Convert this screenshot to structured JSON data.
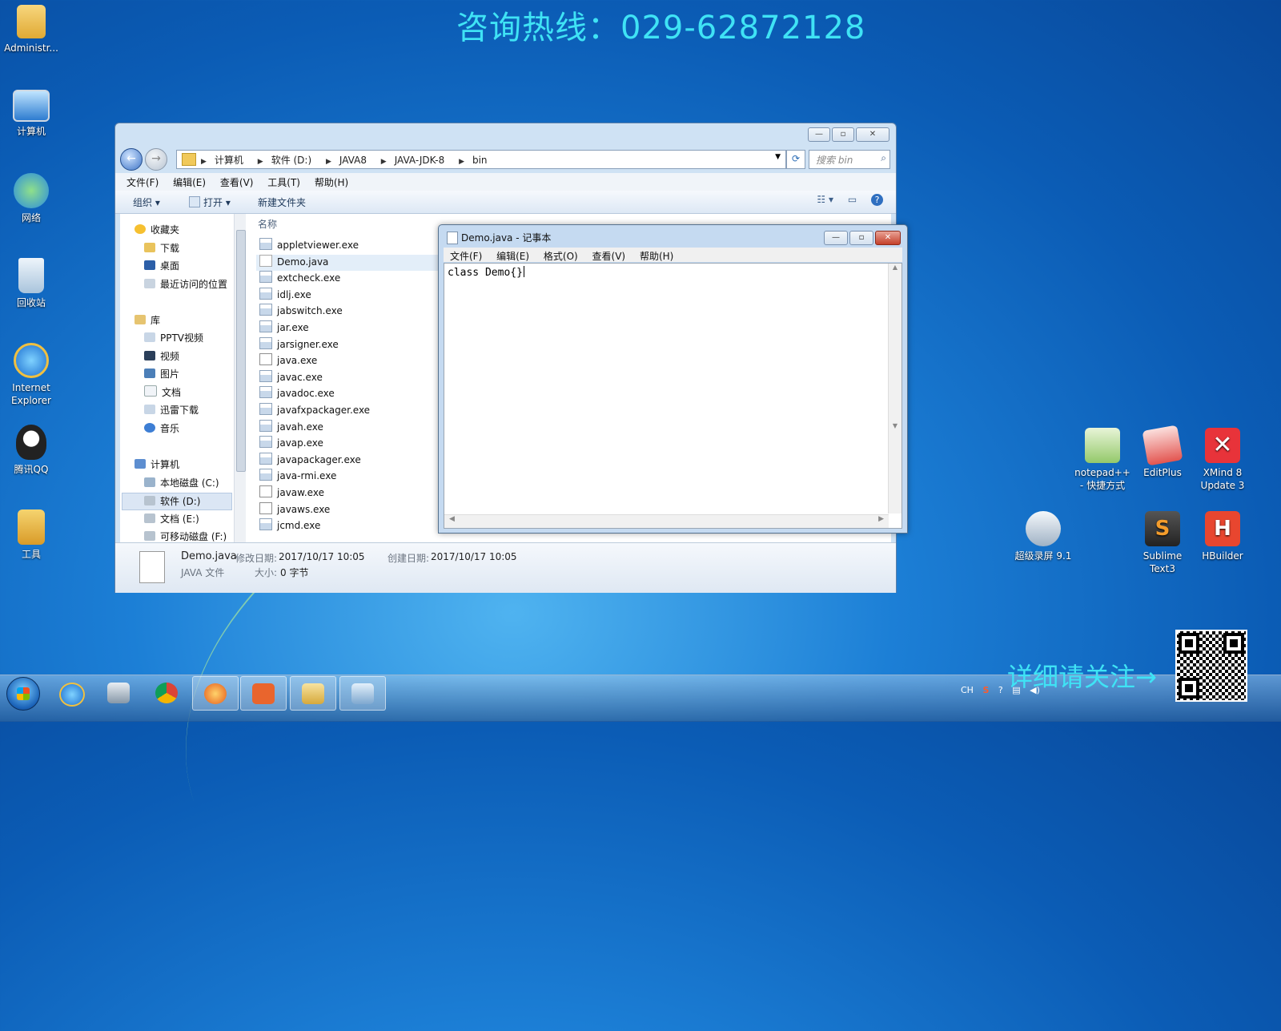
{
  "banner": "咨询热线：029-62872128",
  "follow_text": "详细请关注→",
  "desktop_icons": [
    {
      "label": "Administr...",
      "icon": "user-folder-icon",
      "color": "#f2c14e"
    },
    {
      "label": "计算机",
      "icon": "computer-icon",
      "color": "#5aa7e8"
    },
    {
      "label": "网络",
      "icon": "network-icon",
      "color": "#58b0ea"
    },
    {
      "label": "回收站",
      "icon": "recycle-bin-icon",
      "color": "#d5e6f2"
    },
    {
      "label": "Internet\nExplorer",
      "icon": "ie-icon",
      "color": "#2f8de4"
    },
    {
      "label": "腾讯QQ",
      "icon": "qq-icon",
      "color": "#222222"
    },
    {
      "label": "工具",
      "icon": "tools-folder-icon",
      "color": "#f0c555"
    },
    {
      "label": "notepad++\n- 快捷方式",
      "icon": "notepadpp-icon",
      "color": "#9bd36a"
    },
    {
      "label": "EditPlus",
      "icon": "editplus-icon",
      "color": "#e65a55"
    },
    {
      "label": "XMind 8\nUpdate 3",
      "icon": "xmind-icon",
      "color": "#e8333a"
    },
    {
      "label": "超级录屏 9.1",
      "icon": "screen-recorder-icon",
      "color": "#dfe7ef"
    },
    {
      "label": "Sublime\nText3",
      "icon": "sublime-icon",
      "color": "#3a3a3a"
    },
    {
      "label": "HBuilder",
      "icon": "hbuilder-icon",
      "color": "#e8462f"
    }
  ],
  "explorer": {
    "breadcrumbs": [
      "计算机",
      "软件 (D:)",
      "JAVA8",
      "JAVA-JDK-8",
      "bin"
    ],
    "search_placeholder": "搜索 bin",
    "menu": [
      "文件(F)",
      "编辑(E)",
      "查看(V)",
      "工具(T)",
      "帮助(H)"
    ],
    "toolbar": {
      "organize": "组织 ▾",
      "open": "打开 ▾",
      "new_folder": "新建文件夹"
    },
    "column_name": "名称",
    "nav": {
      "favorites": "收藏夹",
      "downloads": "下载",
      "desktop": "桌面",
      "recent": "最近访问的位置",
      "libraries": "库",
      "pptv": "PPTV视频",
      "videos": "视频",
      "pictures": "图片",
      "documents": "文档",
      "thunder": "迅雷下载",
      "music": "音乐",
      "computer": "计算机",
      "drive_c": "本地磁盘 (C:)",
      "drive_d": "软件 (D:)",
      "drive_e": "文档 (E:)",
      "drive_f": "可移动磁盘 (F:)"
    },
    "files": [
      {
        "name": "appletviewer.exe",
        "kind": "exe"
      },
      {
        "name": "Demo.java",
        "kind": "txt",
        "selected": true
      },
      {
        "name": "extcheck.exe",
        "kind": "exe"
      },
      {
        "name": "idlj.exe",
        "kind": "exe"
      },
      {
        "name": "jabswitch.exe",
        "kind": "exe"
      },
      {
        "name": "jar.exe",
        "kind": "exe"
      },
      {
        "name": "jarsigner.exe",
        "kind": "exe"
      },
      {
        "name": "java.exe",
        "kind": "java"
      },
      {
        "name": "javac.exe",
        "kind": "exe"
      },
      {
        "name": "javadoc.exe",
        "kind": "exe"
      },
      {
        "name": "javafxpackager.exe",
        "kind": "exe"
      },
      {
        "name": "javah.exe",
        "kind": "exe"
      },
      {
        "name": "javap.exe",
        "kind": "exe"
      },
      {
        "name": "javapackager.exe",
        "kind": "exe"
      },
      {
        "name": "java-rmi.exe",
        "kind": "exe"
      },
      {
        "name": "javaw.exe",
        "kind": "java"
      },
      {
        "name": "javaws.exe",
        "kind": "java"
      },
      {
        "name": "jcmd.exe",
        "kind": "exe"
      }
    ],
    "details": {
      "filename": "Demo.java",
      "type": "JAVA 文件",
      "modified_label": "修改日期:",
      "modified": "2017/10/17 10:05",
      "created_label": "创建日期:",
      "created": "2017/10/17 10:05",
      "size_label": "大小:",
      "size": "0 字节"
    }
  },
  "notepad": {
    "title": "Demo.java - 记事本",
    "menu": [
      "文件(F)",
      "编辑(E)",
      "格式(O)",
      "查看(V)",
      "帮助(H)"
    ],
    "content": "class Demo{}"
  },
  "taskbar": {
    "apps": [
      "ie-icon",
      "video-editor-icon",
      "chrome-icon",
      "firefox-icon",
      "powerpoint-icon",
      "explorer-icon",
      "notepad-icon"
    ],
    "tray_lang": "CH"
  }
}
